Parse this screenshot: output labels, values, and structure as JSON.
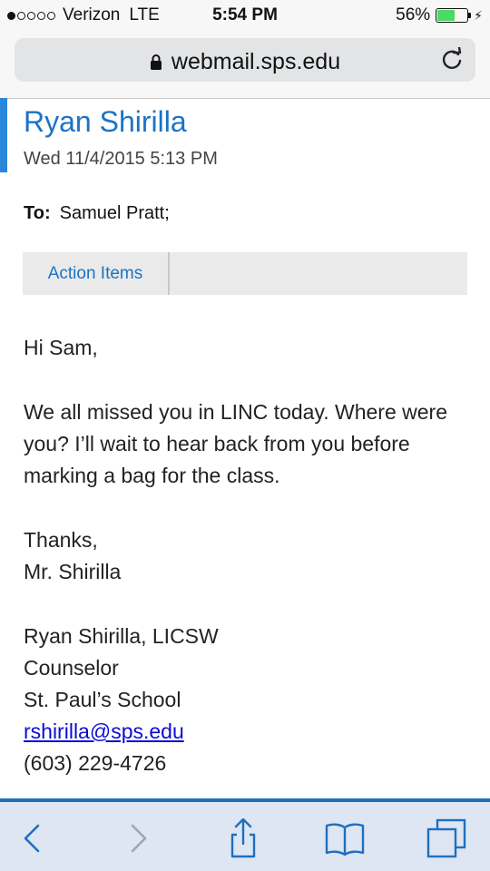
{
  "status_bar": {
    "carrier": "Verizon",
    "network": "LTE",
    "time": "5:54 PM",
    "battery": "56%",
    "battery_level": 0.56,
    "signal_bars": 1
  },
  "address_bar": {
    "url": "webmail.sps.edu"
  },
  "email": {
    "sender": "Ryan Shirilla",
    "date": "Wed 11/4/2015 5:13 PM",
    "to_label": "To:",
    "to_value": "Samuel Pratt;",
    "action_tab": "Action Items",
    "greeting": "Hi Sam,",
    "paragraph": "We all missed you in LINC today. Where were you? I’ll wait to hear back from you before marking a bag for the class.",
    "closing": "Thanks,",
    "closing_name": "Mr. Shirilla",
    "signature": {
      "name": "Ryan Shirilla, LICSW",
      "title": "Counselor",
      "school": "St. Paul’s School",
      "email": "rshirilla@sps.edu",
      "phone": "(603) 229-4726"
    }
  },
  "toolbar": {
    "icons": [
      "back-icon",
      "forward-icon",
      "share-icon",
      "bookmarks-icon",
      "tabs-icon"
    ]
  },
  "colors": {
    "accent": "#2a86d8",
    "sender": "#1b73c4",
    "link": "#0b0bd8",
    "toolbar_bg": "#dde6f2"
  }
}
